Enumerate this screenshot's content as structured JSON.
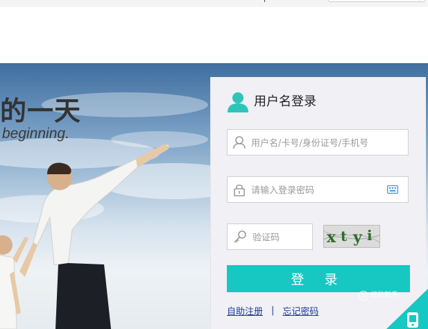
{
  "hero": {
    "slogan": "的一天",
    "subslogan": "beginning."
  },
  "login": {
    "title": "用户名登录",
    "username_placeholder": "用户名/卡号/身份证号/手机号",
    "password_placeholder": "请输入登录密码",
    "captcha_placeholder": "验证码",
    "captcha_text": "xtyi",
    "submit_label": "登 录",
    "register_link": "自助注册",
    "separator": "|",
    "forgot_link": "忘记密码"
  },
  "watermark": {
    "badge": "S",
    "text": "经验新手"
  },
  "colors": {
    "accent": "#17c7c1",
    "link": "#1a3a9a",
    "panel_bg": "#f0f0f5"
  },
  "icons": {
    "title": "user-avatar-icon",
    "username": "person-outline-icon",
    "password": "lock-icon",
    "keyboard": "keyboard-icon",
    "captcha": "key-icon",
    "corner": "mobile-phone-icon"
  }
}
